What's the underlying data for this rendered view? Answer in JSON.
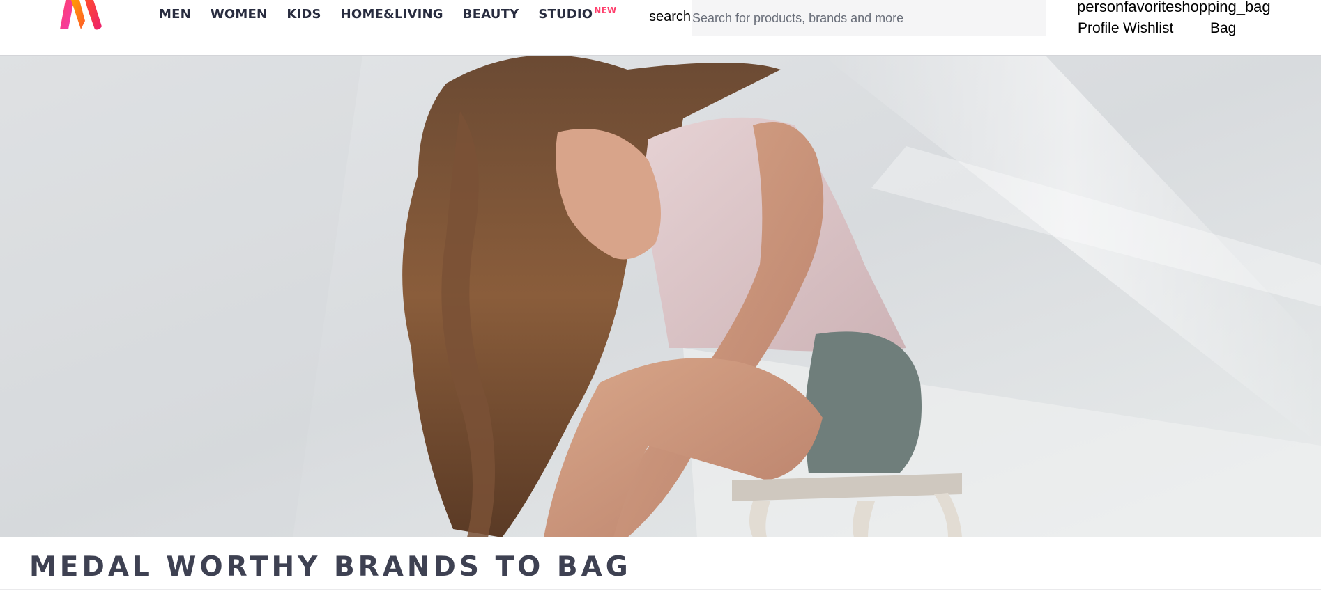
{
  "brand": {
    "logo_icon": "myntra-logo-icon"
  },
  "nav": {
    "items": [
      {
        "label": "MEN"
      },
      {
        "label": "WOMEN"
      },
      {
        "label": "KIDS"
      },
      {
        "label": "HOME&LIVING"
      },
      {
        "label": "BEAUTY"
      },
      {
        "label": "STUDIO",
        "badge": "NEW"
      }
    ]
  },
  "search": {
    "icon_text": "search",
    "placeholder": "Search for products, brands and more",
    "value": ""
  },
  "actions": {
    "icons_text": "personfavoriteshopping_bag",
    "profile_label": "Profile",
    "wishlist_label": "Wishlist",
    "bag_label": "Bag"
  },
  "hero": {
    "image": "hero-banner-model-on-stool"
  },
  "section": {
    "title": "MEDAL WORTHY BRANDS TO BAG"
  },
  "colors": {
    "accent": "#ff3f6c",
    "nav_text": "#282c3f",
    "title_text": "#3e4152",
    "search_bg": "#f5f5f6"
  }
}
